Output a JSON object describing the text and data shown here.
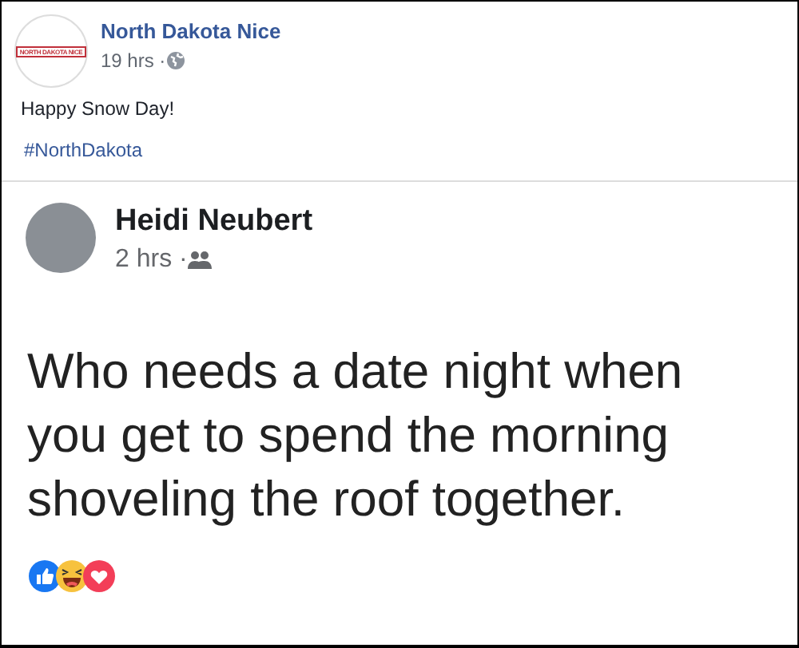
{
  "page_post": {
    "logo_text": "NORTH DAKOTA NICE",
    "author": "North Dakota Nice",
    "time": "19 hrs · ",
    "text": "Happy Snow Day!",
    "hashtag": "#NorthDakota"
  },
  "shared_post": {
    "author": "Heidi Neubert",
    "time": "2 hrs · ",
    "text": "Who needs a date night when you get to spend the morning shoveling the roof together."
  }
}
